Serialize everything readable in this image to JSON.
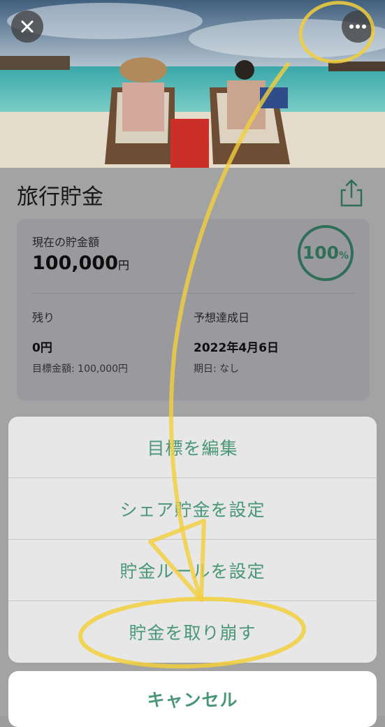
{
  "header": {
    "close_icon": "close-icon",
    "more_icon": "ellipsis-icon",
    "hero_image": "beach-photo"
  },
  "goal": {
    "title": "旅行貯金",
    "share_icon": "share-icon"
  },
  "summary": {
    "current_label": "現在の貯金額",
    "current_amount": "100,000",
    "currency": "円",
    "progress_value": "100",
    "progress_unit": "%",
    "progress_fraction": 1.0,
    "remaining_label": "残り",
    "remaining_amount": "0円",
    "target_text": "目標金額: 100,000円",
    "expected_label": "予想達成日",
    "expected_date": "2022年4月6日",
    "deadline_text": "期日: なし"
  },
  "action_sheet": {
    "items": [
      "目標を編集",
      "シェア貯金を設定",
      "貯金ルールを設定",
      "貯金を取り崩す"
    ],
    "cancel_label": "キャンセル"
  },
  "colors": {
    "accent": "#4a9778",
    "ring": "#2f6e57",
    "annotation": "#f2cf3c"
  }
}
